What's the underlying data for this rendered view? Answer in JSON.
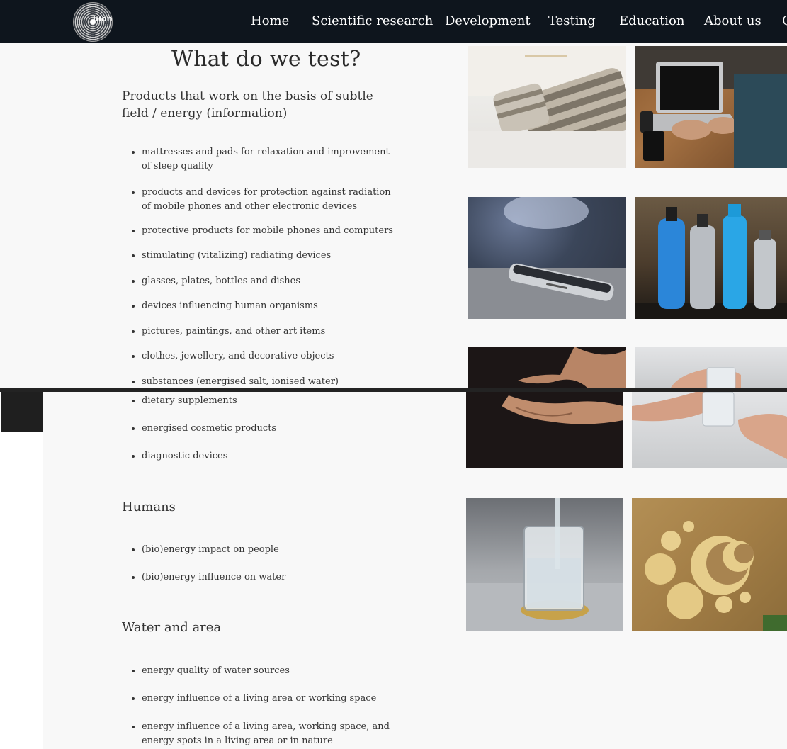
{
  "brand": {
    "logo_text": "bion"
  },
  "nav": {
    "items": [
      "Home",
      "Scientific research",
      "Development",
      "Testing",
      "Education",
      "About us",
      "C"
    ]
  },
  "main": {
    "title": "What do we test?",
    "products": {
      "heading": "Products that work on the basis of subtle field / energy (information)",
      "items_upper": [
        "mattresses and pads for relaxation and improvement of sleep quality",
        "products and devices for protection against radiation of mobile phones and other electronic devices",
        "protective products for mobile phones and computers",
        "stimulating (vitalizing) radiating devices",
        "glasses, plates, bottles and dishes",
        "devices influencing human organisms",
        "pictures, paintings, and other art items",
        "clothes, jewellery, and decorative objects",
        "substances (energised salt, ionised water)"
      ],
      "items_lower": [
        "dietary supplements",
        "energised cosmetic products",
        "diagnostic devices"
      ]
    },
    "humans": {
      "heading": "Humans",
      "items": [
        "(bio)energy impact on people",
        "(bio)energy influence on water"
      ]
    },
    "water": {
      "heading": "Water and area",
      "items": [
        "energy quality of water sources",
        "energy influence of a living area or working space",
        "energy influence of a living area, working space, and energy spots in a living area or in nature"
      ]
    }
  },
  "colors": {
    "nav_bg": "#0e151d",
    "panel_bg": "#f8f8f8",
    "divider": "#232323",
    "text": "#333333"
  }
}
